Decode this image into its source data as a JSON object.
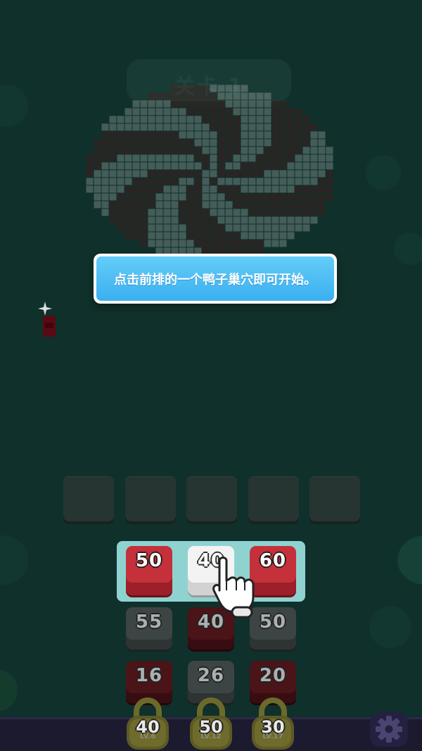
{
  "game": {
    "level_title": "关卡 1",
    "tutorial_text": "点击前排的一个鸭子巢穴即可开始。"
  },
  "colors": {
    "background": "#10302b",
    "candy_red": "#6b0c10",
    "candy_white": "#cfd3d2",
    "nest_red": "#c4313b",
    "tutorial_blue": "#3aaff0",
    "highlight": "#8fd3d1"
  },
  "front_row": [
    {
      "value": "50",
      "color": "red"
    },
    {
      "value": "40",
      "color": "white"
    },
    {
      "value": "60",
      "color": "red"
    }
  ],
  "row2": [
    {
      "value": "55",
      "color": "gray"
    },
    {
      "value": "40",
      "color": "red"
    },
    {
      "value": "50",
      "color": "gray"
    }
  ],
  "row3": [
    {
      "value": "16",
      "color": "red"
    },
    {
      "value": "26",
      "color": "gray"
    },
    {
      "value": "20",
      "color": "red"
    }
  ],
  "locks": [
    {
      "value": "40",
      "level": "LV.6"
    },
    {
      "value": "50",
      "level": "LV.12"
    },
    {
      "value": "30",
      "level": "LV.17"
    }
  ],
  "icons": {
    "settings": "gear-icon",
    "pointer": "pointing-hand-icon",
    "lock": "padlock-icon"
  }
}
